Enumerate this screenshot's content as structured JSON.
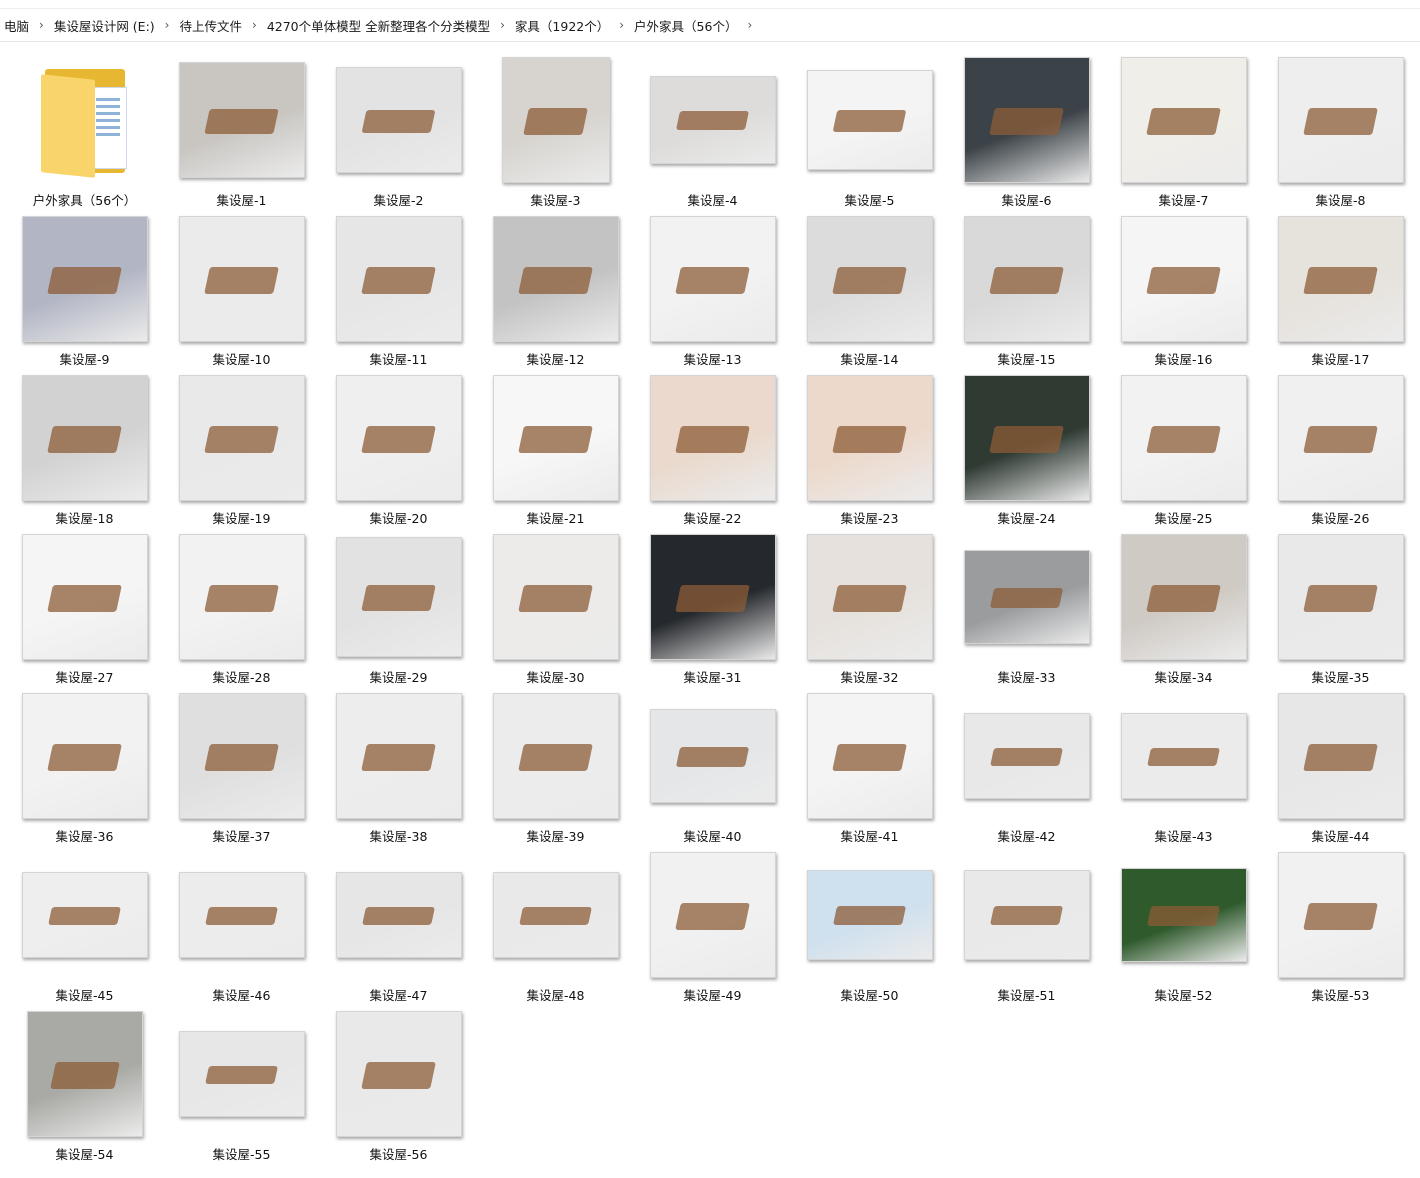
{
  "breadcrumb": [
    "电脑",
    "集设屋设计网 (E:)",
    "待上传文件",
    "4270个单体模型 全新整理各个分类模型",
    "家具（1922个）",
    "户外家具（56个）"
  ],
  "folder": {
    "label": "户外家具（56个）",
    "icon": "folder-icon"
  },
  "items": [
    {
      "label": "集设屋-1",
      "bg": "#c9c6c2"
    },
    {
      "label": "集设屋-2",
      "bg": "#e3e3e3"
    },
    {
      "label": "集设屋-3",
      "bg": "#d7d4cf"
    },
    {
      "label": "集设屋-4",
      "bg": "#dddcda"
    },
    {
      "label": "集设屋-5",
      "bg": "#f4f4f4"
    },
    {
      "label": "集设屋-6",
      "bg": "#3c4348"
    },
    {
      "label": "集设屋-7",
      "bg": "#f0eee8"
    },
    {
      "label": "集设屋-8",
      "bg": "#eeeeee"
    },
    {
      "label": "集设屋-9",
      "bg": "#b2b5c4"
    },
    {
      "label": "集设屋-10",
      "bg": "#ebebeb"
    },
    {
      "label": "集设屋-11",
      "bg": "#e6e6e6"
    },
    {
      "label": "集设屋-12",
      "bg": "#c3c3c3"
    },
    {
      "label": "集设屋-13",
      "bg": "#f2f2f2"
    },
    {
      "label": "集设屋-14",
      "bg": "#dcdcdc"
    },
    {
      "label": "集设屋-15",
      "bg": "#d9d9d9"
    },
    {
      "label": "集设屋-16",
      "bg": "#f5f5f5"
    },
    {
      "label": "集设屋-17",
      "bg": "#e6e2dc"
    },
    {
      "label": "集设屋-18",
      "bg": "#d2d2d2"
    },
    {
      "label": "集设屋-19",
      "bg": "#e9e9e9"
    },
    {
      "label": "集设屋-20",
      "bg": "#efefef"
    },
    {
      "label": "集设屋-21",
      "bg": "#f7f7f7"
    },
    {
      "label": "集设屋-22",
      "bg": "#ead9cc"
    },
    {
      "label": "集设屋-23",
      "bg": "#ecd9cb"
    },
    {
      "label": "集设屋-24",
      "bg": "#2f3a33"
    },
    {
      "label": "集设屋-25",
      "bg": "#f2f2f2"
    },
    {
      "label": "集设屋-26",
      "bg": "#f0f0f0"
    },
    {
      "label": "集设屋-27",
      "bg": "#f5f5f5"
    },
    {
      "label": "集设屋-28",
      "bg": "#f2f2f2"
    },
    {
      "label": "集设屋-29",
      "bg": "#e2e2e2"
    },
    {
      "label": "集设屋-30",
      "bg": "#ecebe9"
    },
    {
      "label": "集设屋-31",
      "bg": "#25282c"
    },
    {
      "label": "集设屋-32",
      "bg": "#e6e1dc"
    },
    {
      "label": "集设屋-33",
      "bg": "#9a9c9e"
    },
    {
      "label": "集设屋-34",
      "bg": "#cfcac4"
    },
    {
      "label": "集设屋-35",
      "bg": "#e9e9e9"
    },
    {
      "label": "集设屋-36",
      "bg": "#f2f2f2"
    },
    {
      "label": "集设屋-37",
      "bg": "#dfdfdf"
    },
    {
      "label": "集设屋-38",
      "bg": "#ededed"
    },
    {
      "label": "集设屋-39",
      "bg": "#ececec"
    },
    {
      "label": "集设屋-40",
      "bg": "#e4e6e8"
    },
    {
      "label": "集设屋-41",
      "bg": "#f4f4f4"
    },
    {
      "label": "集设屋-42",
      "bg": "#e8e8e8"
    },
    {
      "label": "集设屋-43",
      "bg": "#ebebeb"
    },
    {
      "label": "集设屋-44",
      "bg": "#e7e7e7"
    },
    {
      "label": "集设屋-45",
      "bg": "#eeeeee"
    },
    {
      "label": "集设屋-46",
      "bg": "#ececec"
    },
    {
      "label": "集设屋-47",
      "bg": "#e6e6e6"
    },
    {
      "label": "集设屋-48",
      "bg": "#e9e9e9"
    },
    {
      "label": "集设屋-49",
      "bg": "#f1f1f1"
    },
    {
      "label": "集设屋-50",
      "bg": "#cfe0ee"
    },
    {
      "label": "集设屋-51",
      "bg": "#e9e9e9"
    },
    {
      "label": "集设屋-52",
      "bg": "#2f5a2c"
    },
    {
      "label": "集设屋-53",
      "bg": "#f1f1f1"
    },
    {
      "label": "集设屋-54",
      "bg": "#a9aaa5"
    },
    {
      "label": "集设屋-55",
      "bg": "#e7e7e7"
    },
    {
      "label": "集设屋-56",
      "bg": "#e9e9e9"
    }
  ]
}
